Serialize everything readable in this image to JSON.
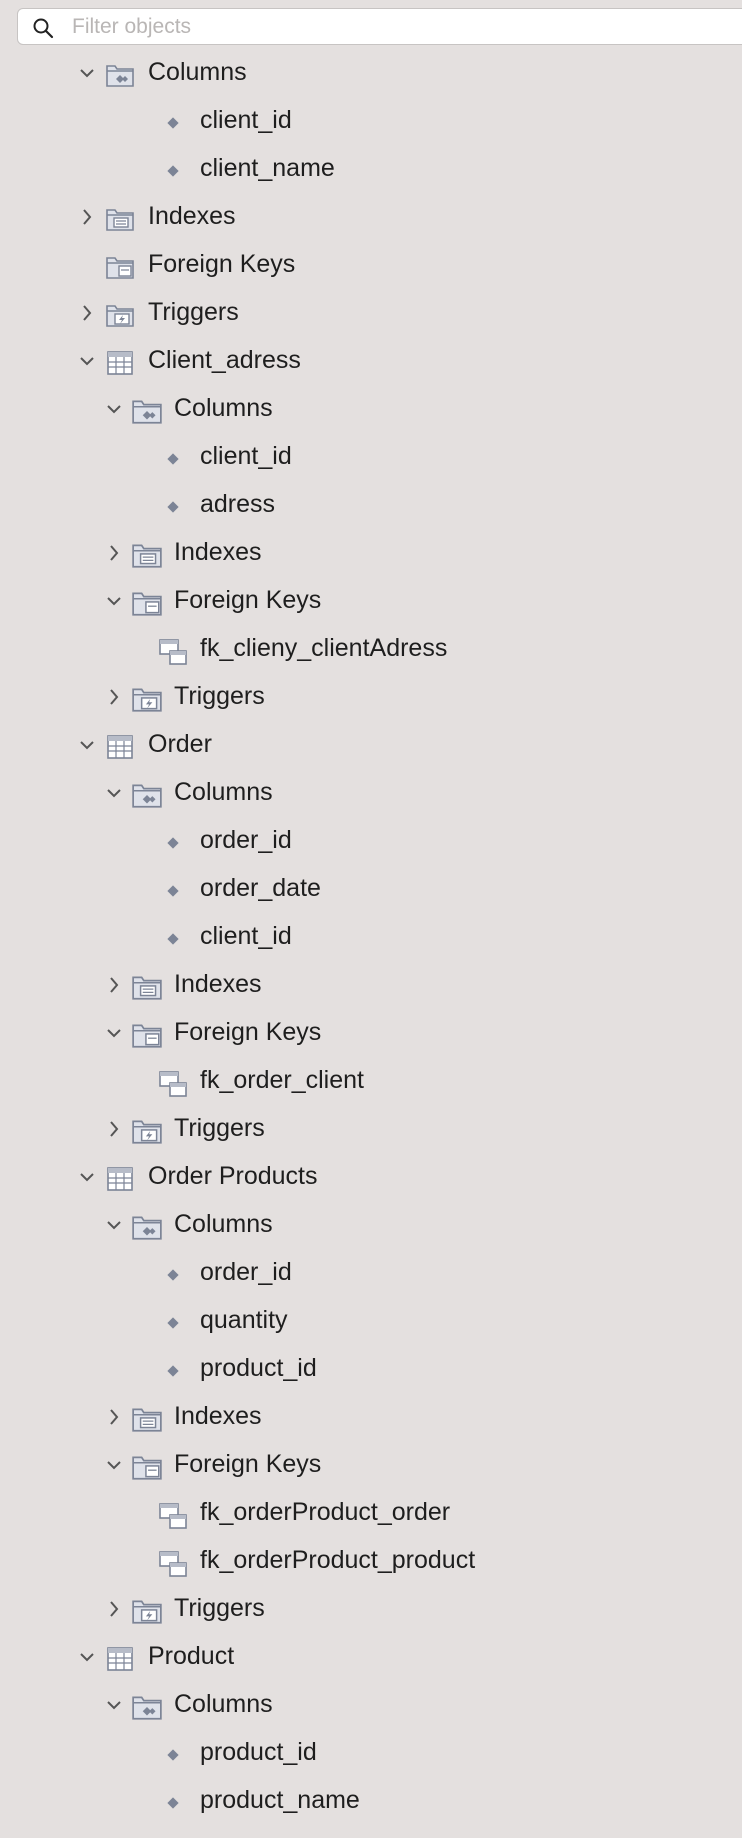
{
  "search": {
    "placeholder": "Filter objects"
  },
  "colors": {
    "background": "#e4e0df",
    "icon": "#7c8496",
    "chevron": "#555555"
  },
  "tree": {
    "rows": [
      {
        "label": "Columns",
        "icon": "columns-folder-icon",
        "state": "expanded"
      },
      {
        "label": "client_id",
        "icon": "column-diamond-icon"
      },
      {
        "label": "client_name",
        "icon": "column-diamond-icon"
      },
      {
        "label": "Indexes",
        "icon": "indexes-folder-icon",
        "state": "collapsed"
      },
      {
        "label": "Foreign Keys",
        "icon": "foreign-keys-folder-icon",
        "state": "none"
      },
      {
        "label": "Triggers",
        "icon": "triggers-folder-icon",
        "state": "collapsed"
      },
      {
        "label": "Client_adress",
        "icon": "table-icon",
        "state": "expanded"
      },
      {
        "label": "Columns",
        "icon": "columns-folder-icon",
        "state": "expanded"
      },
      {
        "label": "client_id",
        "icon": "column-diamond-icon"
      },
      {
        "label": "adress",
        "icon": "column-diamond-icon"
      },
      {
        "label": "Indexes",
        "icon": "indexes-folder-icon",
        "state": "collapsed"
      },
      {
        "label": "Foreign Keys",
        "icon": "foreign-keys-folder-icon",
        "state": "expanded"
      },
      {
        "label": "fk_clieny_clientAdress",
        "icon": "foreign-key-icon"
      },
      {
        "label": "Triggers",
        "icon": "triggers-folder-icon",
        "state": "collapsed"
      },
      {
        "label": "Order",
        "icon": "table-icon",
        "state": "expanded"
      },
      {
        "label": "Columns",
        "icon": "columns-folder-icon",
        "state": "expanded"
      },
      {
        "label": "order_id",
        "icon": "column-diamond-icon"
      },
      {
        "label": "order_date",
        "icon": "column-diamond-icon"
      },
      {
        "label": "client_id",
        "icon": "column-diamond-icon"
      },
      {
        "label": "Indexes",
        "icon": "indexes-folder-icon",
        "state": "collapsed"
      },
      {
        "label": "Foreign Keys",
        "icon": "foreign-keys-folder-icon",
        "state": "expanded"
      },
      {
        "label": "fk_order_client",
        "icon": "foreign-key-icon"
      },
      {
        "label": "Triggers",
        "icon": "triggers-folder-icon",
        "state": "collapsed"
      },
      {
        "label": "Order Products",
        "icon": "table-icon",
        "state": "expanded"
      },
      {
        "label": "Columns",
        "icon": "columns-folder-icon",
        "state": "expanded"
      },
      {
        "label": "order_id",
        "icon": "column-diamond-icon"
      },
      {
        "label": "quantity",
        "icon": "column-diamond-icon"
      },
      {
        "label": "product_id",
        "icon": "column-diamond-icon"
      },
      {
        "label": "Indexes",
        "icon": "indexes-folder-icon",
        "state": "collapsed"
      },
      {
        "label": "Foreign Keys",
        "icon": "foreign-keys-folder-icon",
        "state": "expanded"
      },
      {
        "label": "fk_orderProduct_order",
        "icon": "foreign-key-icon"
      },
      {
        "label": "fk_orderProduct_product",
        "icon": "foreign-key-icon"
      },
      {
        "label": "Triggers",
        "icon": "triggers-folder-icon",
        "state": "collapsed"
      },
      {
        "label": "Product",
        "icon": "table-icon",
        "state": "expanded"
      },
      {
        "label": "Columns",
        "icon": "columns-folder-icon",
        "state": "expanded"
      },
      {
        "label": "product_id",
        "icon": "column-diamond-icon"
      },
      {
        "label": "product_name",
        "icon": "column-diamond-icon"
      }
    ]
  }
}
